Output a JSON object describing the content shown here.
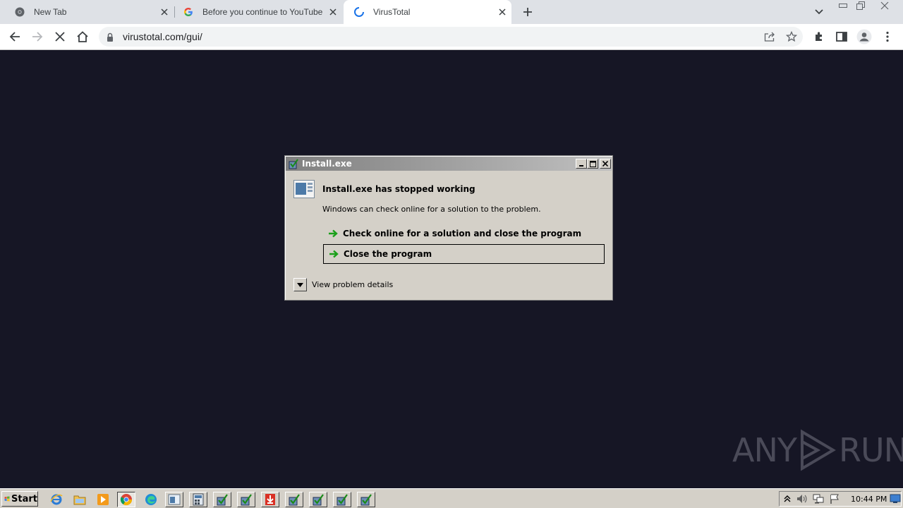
{
  "browser": {
    "tabs": [
      {
        "title": "New Tab",
        "favicon": "chrome-icon"
      },
      {
        "title": "Before you continue to YouTube",
        "favicon": "google-icon"
      },
      {
        "title": "VirusTotal",
        "favicon": "loading-spinner-icon",
        "active": true
      }
    ],
    "url": "virustotal.com/gui/"
  },
  "dialog": {
    "title": "Install.exe",
    "heading": "Install.exe has stopped working",
    "message": "Windows can check online for a solution to the problem.",
    "options": [
      "Check online for a solution and close the program",
      "Close the program"
    ],
    "details_label": "View problem details"
  },
  "watermark": {
    "left": "ANY",
    "right": "RUN"
  },
  "taskbar": {
    "start_label": "Start",
    "clock": "10:44 PM"
  },
  "colors": {
    "page_background": "#161625",
    "dialog_background": "#d4d0c8",
    "taskbar_background": "#d4d0c8"
  }
}
